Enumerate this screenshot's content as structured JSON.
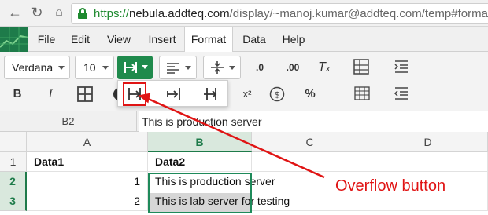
{
  "browser": {
    "url_protocol": "https://",
    "url_host": "nebula.addteq.com",
    "url_path": "/display/~manoj.kumar@addteq.com/temp#formatHe"
  },
  "menu": {
    "items": [
      {
        "label": "File"
      },
      {
        "label": "Edit"
      },
      {
        "label": "View"
      },
      {
        "label": "Insert"
      },
      {
        "label": "Format",
        "active": true
      },
      {
        "label": "Data"
      },
      {
        "label": "Help"
      }
    ]
  },
  "toolbar": {
    "font_family": "Verdana",
    "font_size": "10",
    "bold_label": "B",
    "italic_label": "I",
    "percent_label": "%",
    "superscript_label": "x²",
    "accent_color": "#1f8a4c"
  },
  "formula_bar": {
    "cell_ref": "B2",
    "value": "This is production server"
  },
  "grid": {
    "columns": [
      "A",
      "B",
      "C",
      "D"
    ],
    "rows": [
      {
        "num": "1",
        "a": "Data1",
        "b": "Data2"
      },
      {
        "num": "2",
        "a": "1",
        "b": "This is production server"
      },
      {
        "num": "3",
        "a": "2",
        "b": "This is lab server for testing"
      }
    ]
  },
  "annotation": {
    "label": "Overflow button",
    "color": "#e01414"
  }
}
